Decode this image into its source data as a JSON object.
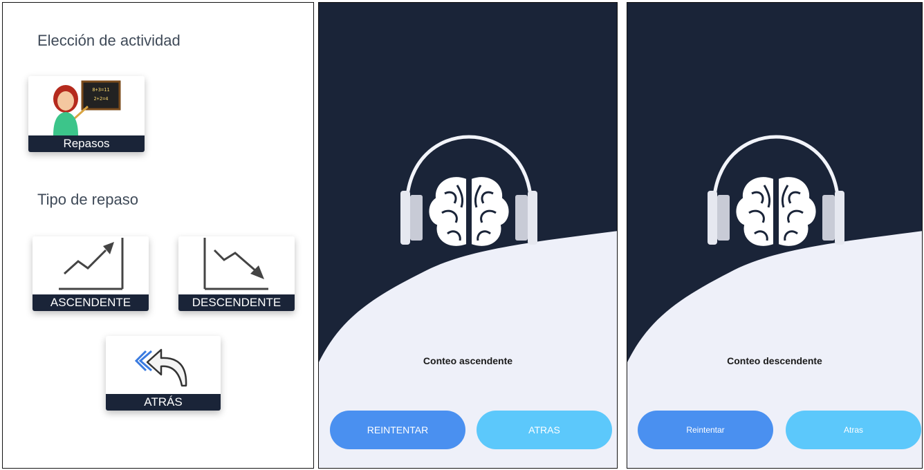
{
  "activity_screen": {
    "title": "Elección de actividad",
    "repasos_label": "Repasos",
    "review_type_title": "Tipo de repaso",
    "ascendente_label": "ASCENDENTE",
    "descendente_label": "DESCENDENTE",
    "atras_label": "ATRÁS",
    "chalkboard_line1": "8+3=11",
    "chalkboard_line2": "2+2=4"
  },
  "ascending_screen": {
    "caption": "Conteo ascendente",
    "retry_label": "REINTENTAR",
    "back_label": "ATRAS"
  },
  "descending_screen": {
    "caption": "Conteo descendente",
    "retry_label": "Reintentar",
    "back_label": "Atras"
  },
  "colors": {
    "navy": "#1a2438",
    "light_bg": "#eef0f9",
    "retry_blue": "#4a90f0",
    "back_cyan": "#5cc8fb"
  }
}
